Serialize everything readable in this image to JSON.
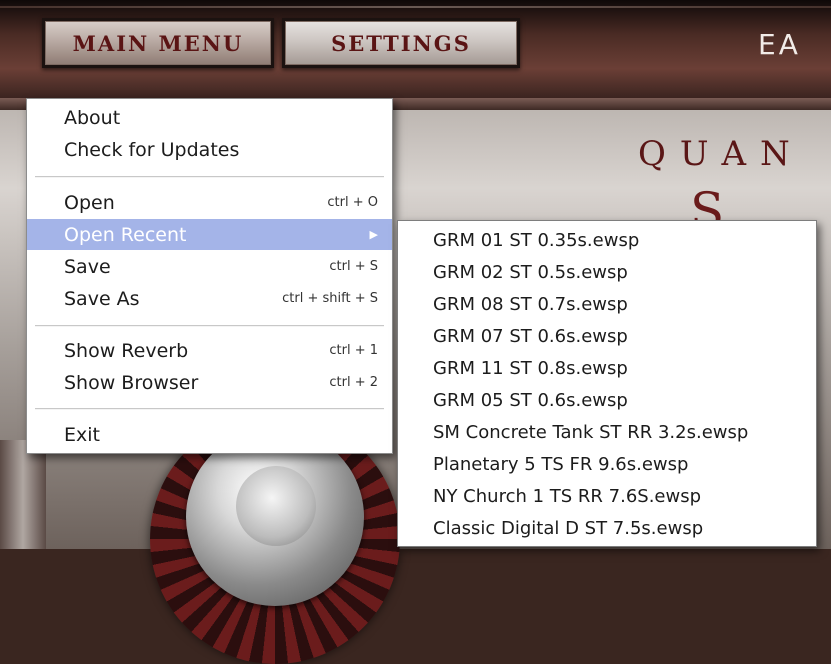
{
  "header": {
    "main_menu_label": "MAIN MENU",
    "settings_label": "SETTINGS",
    "brand_partial": "EA"
  },
  "panel": {
    "brand_line1": "QUAN",
    "brand_line2": "S D"
  },
  "menu": {
    "items": [
      {
        "label": "About",
        "shortcut": ""
      },
      {
        "label": "Check for Updates",
        "shortcut": ""
      },
      {
        "label": "Open",
        "shortcut": "ctrl + O"
      },
      {
        "label": "Open Recent",
        "shortcut": "",
        "has_submenu": true,
        "highlighted": true
      },
      {
        "label": "Save",
        "shortcut": "ctrl + S"
      },
      {
        "label": "Save As",
        "shortcut": "ctrl + shift + S"
      },
      {
        "label": "Show Reverb",
        "shortcut": "ctrl + 1"
      },
      {
        "label": "Show Browser",
        "shortcut": "ctrl + 2"
      },
      {
        "label": "Exit",
        "shortcut": ""
      }
    ],
    "submenu_arrow_icon": "chevron-right-icon",
    "highlight_color": "#a4b4e8"
  },
  "submenu": {
    "items": [
      "GRM 01 ST 0.35s.ewsp",
      "GRM 02 ST 0.5s.ewsp",
      "GRM 08 ST 0.7s.ewsp",
      "GRM 07 ST 0.6s.ewsp",
      "GRM 11 ST 0.8s.ewsp",
      "GRM 05 ST 0.6s.ewsp",
      "SM Concrete Tank ST RR 3.2s.ewsp",
      "Planetary 5 TS FR 9.6s.ewsp",
      "NY Church 1 TS RR 7.6S.ewsp",
      "Classic Digital D ST 7.5s.ewsp"
    ]
  }
}
